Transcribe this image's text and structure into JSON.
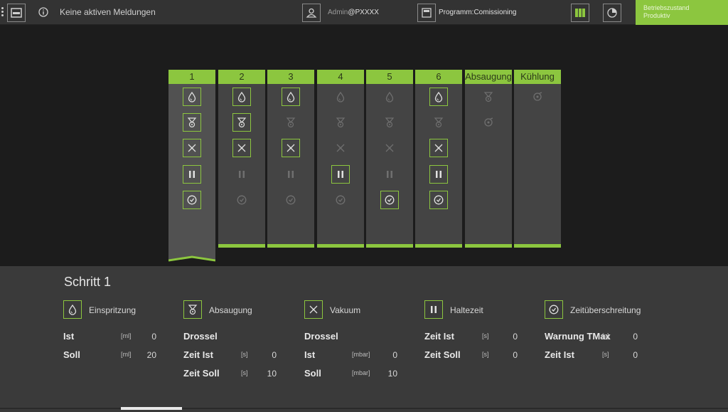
{
  "topbar": {
    "messages": "Keine aktiven Meldungen",
    "user_prefix": "Admin",
    "user_suffix": "@PXXXX",
    "program": "Programm:Comissioning",
    "status_line1": "Betriebszustand",
    "status_line2": "Produktiv"
  },
  "columns": [
    {
      "label": "1",
      "active": true,
      "icons": [
        "drop-icon",
        "fan-icon",
        "spiral-icon",
        "pause-icon",
        "timer-icon"
      ],
      "on": [
        true,
        true,
        true,
        true,
        true
      ]
    },
    {
      "label": "2",
      "active": false,
      "icons": [
        "drop-icon",
        "fan-icon",
        "spiral-icon",
        "pause-icon",
        "timer-icon"
      ],
      "on": [
        true,
        true,
        true,
        false,
        false
      ]
    },
    {
      "label": "3",
      "active": false,
      "icons": [
        "drop-icon",
        "fan-icon",
        "spiral-icon",
        "pause-icon",
        "timer-icon"
      ],
      "on": [
        true,
        false,
        true,
        false,
        false
      ]
    },
    {
      "label": "4",
      "active": false,
      "icons": [
        "drop-icon",
        "fan-icon",
        "spiral-icon",
        "pause-icon",
        "timer-icon"
      ],
      "on": [
        false,
        false,
        false,
        true,
        false
      ]
    },
    {
      "label": "5",
      "active": false,
      "icons": [
        "drop-icon",
        "fan-icon",
        "spiral-icon",
        "pause-icon",
        "timer-icon"
      ],
      "on": [
        false,
        false,
        false,
        false,
        true
      ]
    },
    {
      "label": "6",
      "active": false,
      "icons": [
        "drop-icon",
        "fan-icon",
        "spiral-icon",
        "pause-icon",
        "timer-icon"
      ],
      "on": [
        true,
        false,
        true,
        true,
        true
      ]
    },
    {
      "label": "Absaugung",
      "active": false,
      "icons": [
        "fan-icon",
        "gear-fan-icon"
      ],
      "on": [
        false,
        false
      ]
    },
    {
      "label": "Kühlung",
      "active": false,
      "icons": [
        "gear-fan-icon"
      ],
      "on": [
        false
      ]
    }
  ],
  "step": {
    "title": "Schritt 1",
    "groups": [
      {
        "icon": "drop-icon",
        "label": "Einspritzung",
        "rows": [
          {
            "label": "Ist",
            "unit": "[ml]",
            "value": "0"
          },
          {
            "label": "Soll",
            "unit": "[ml]",
            "value": "20"
          }
        ]
      },
      {
        "icon": "fan-icon",
        "label": "Absaugung",
        "rows": [
          {
            "label": "Drossel",
            "unit": "",
            "value": ""
          },
          {
            "label": "Zeit Ist",
            "unit": "[s]",
            "value": "0"
          },
          {
            "label": "Zeit Soll",
            "unit": "[s]",
            "value": "10"
          }
        ]
      },
      {
        "icon": "spiral-icon",
        "label": "Vakuum",
        "rows": [
          {
            "label": "Drossel",
            "unit": "",
            "value": ""
          },
          {
            "label": "Ist",
            "unit": "[mbar]",
            "value": "0"
          },
          {
            "label": "Soll",
            "unit": "[mbar]",
            "value": "10"
          }
        ]
      },
      {
        "icon": "pause-icon",
        "label": "Haltezeit",
        "rows": [
          {
            "label": "Zeit Ist",
            "unit": "[s]",
            "value": "0"
          },
          {
            "label": "Zeit Soll",
            "unit": "[s]",
            "value": "0"
          }
        ]
      },
      {
        "icon": "timer-icon",
        "label": "Zeitüberschreitung",
        "rows": [
          {
            "label": "Warnung TMax",
            "unit": "[s]",
            "value": "0"
          },
          {
            "label": "Zeit Ist",
            "unit": "[s]",
            "value": "0"
          }
        ]
      }
    ]
  },
  "colors": {
    "accent": "#8cc63f",
    "topbar": "#333333",
    "panel": "#3a3a3a",
    "column": "#444444"
  }
}
